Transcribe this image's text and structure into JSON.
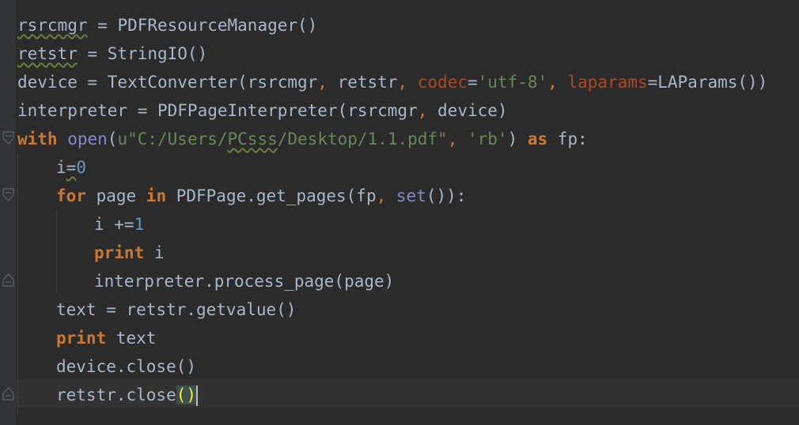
{
  "editor": {
    "language": "python",
    "lines": [
      {
        "t1": "rsrcmgr",
        "t2": " = PDFResourceManager()"
      },
      {
        "t1": "retstr",
        "t2": " = StringIO()"
      },
      {
        "t1": "device = TextConverter(rsrcmgr",
        "t2": ",",
        "t3": " retstr",
        "t4": ",",
        "t5": " codec",
        "t6": "=",
        "t7": "'utf-8'",
        "t8": ",",
        "t9": " laparams",
        "t10": "=LAParams())"
      },
      {
        "t1": "interpreter = PDFPageInterpreter(rsrcmgr",
        "t2": ",",
        "t3": " device)"
      },
      {
        "kw": "with",
        "bi": " open",
        "p1": "(",
        "s1": "u\"C:/Users/",
        "s2": "PCsss",
        "s3": "/Desktop/1.1.pdf\"",
        "c1": ",",
        "s4": " 'rb'",
        "p2": ") ",
        "kw2": "as",
        "rest": " fp:"
      },
      {
        "t1": "i",
        "t2": "=",
        "num": "0"
      },
      {
        "kw": "for",
        "t1": " page ",
        "kw2": "in",
        "t2": " PDFPage.get_pages(fp",
        "c1": ",",
        "bi": " set",
        "t3": "()):"
      },
      {
        "t1": "i +=",
        "num": "1"
      },
      {
        "kw": "print",
        "t1": " i"
      },
      {
        "t1": "interpreter.process_page(page)"
      },
      {
        "t1": "text = retstr.getvalue()"
      },
      {
        "kw": "print",
        "t1": " text"
      },
      {
        "t1": "device.close()"
      },
      {
        "t1": "retstr.close",
        "b1": "(",
        "b2": ")"
      }
    ]
  },
  "colors": {
    "background": "#2b2b2b",
    "keyword": "#cc7832",
    "string": "#6a8759",
    "number": "#6897bb",
    "builtin": "#8888c6",
    "param": "#aa4926",
    "default": "#a9b7c6",
    "brace_match": "#ffef28"
  },
  "icons": [
    "fold-open-icon",
    "fold-close-icon"
  ]
}
